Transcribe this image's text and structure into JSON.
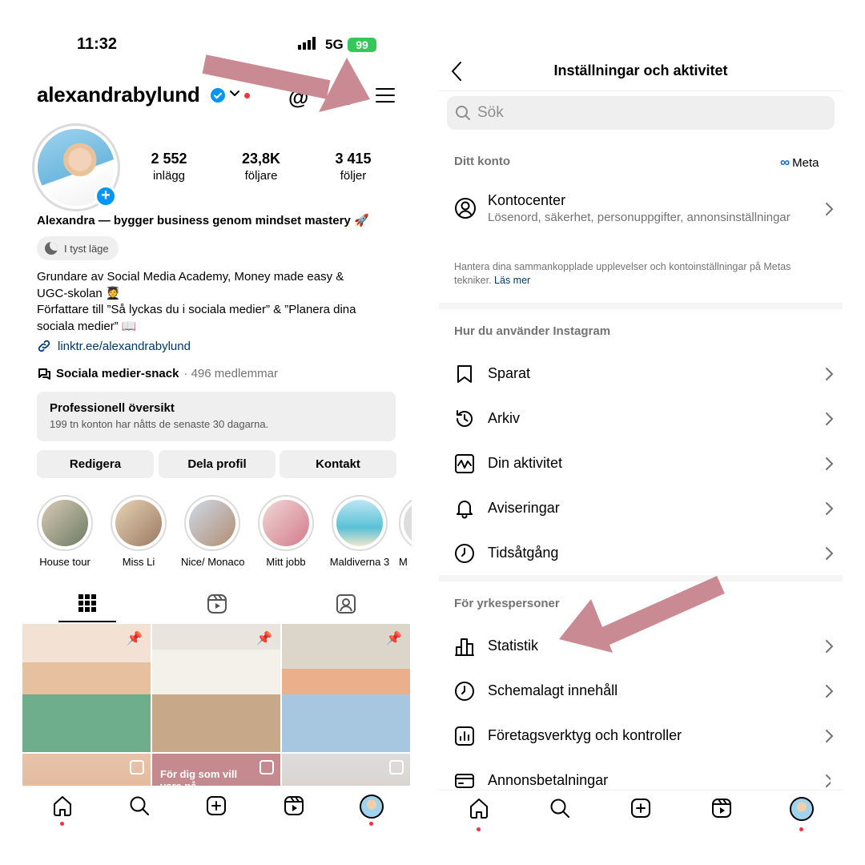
{
  "left": {
    "status": {
      "time": "11:32",
      "network": "5G",
      "battery": "99"
    },
    "header": {
      "username": "alexandrabylund"
    },
    "profile": {
      "stats": [
        {
          "value": "2 552",
          "label": "inlägg"
        },
        {
          "value": "23,8K",
          "label": "följare"
        },
        {
          "value": "3 415",
          "label": "följer"
        }
      ],
      "full_name": "Alexandra — bygger business genom mindset mastery 🚀",
      "quiet_mode": "I tyst läge",
      "bio_lines": [
        "Grundare av Social Media Academy, Money made easy &",
        "UGC-skolan 🧑‍🎓",
        "Författare till ”Så lyckas du i sociala medier” & ”Planera dina",
        "sociala medier” 📖"
      ],
      "link": "linktr.ee/alexandrabylund",
      "channel_name": "Sociala medier-snack",
      "channel_members": "· 496 medlemmar"
    },
    "pro_panel": {
      "title": "Professionell översikt",
      "subtitle": "199 tn konton har nåtts de senaste 30 dagarna."
    },
    "buttons": {
      "edit": "Redigera",
      "share": "Dela profil",
      "contact": "Kontakt"
    },
    "highlights": [
      {
        "label": "House tour"
      },
      {
        "label": "Miss Li"
      },
      {
        "label": "Nice/ Monaco"
      },
      {
        "label": "Mitt jobb"
      },
      {
        "label": "Maldiverna 3"
      },
      {
        "label": "M"
      }
    ],
    "grid_overlay_text": "För dig som vill\nvara på"
  },
  "right": {
    "title": "Inställningar och aktivitet",
    "search_placeholder": "Sök",
    "sections": {
      "account": "Ditt konto",
      "meta_brand": "Meta",
      "usage": "Hur du använder Instagram",
      "pro": "För yrkespersoner"
    },
    "account_center": {
      "title": "Kontocenter",
      "subtitle": "Lösenord, säkerhet, personuppgifter, annonsinställningar"
    },
    "note": {
      "text": "Hantera dina sammankopplade upplevelser och kontoinställningar på Metas tekniker.",
      "link": "Läs mer"
    },
    "usage_items": [
      {
        "label": "Sparat",
        "icon": "bookmark-icon"
      },
      {
        "label": "Arkiv",
        "icon": "archive-icon"
      },
      {
        "label": "Din aktivitet",
        "icon": "activity-icon"
      },
      {
        "label": "Aviseringar",
        "icon": "bell-icon"
      },
      {
        "label": "Tidsåtgång",
        "icon": "clock-icon"
      }
    ],
    "pro_items": [
      {
        "label": "Statistik",
        "icon": "bar-chart-icon"
      },
      {
        "label": "Schemalagt innehåll",
        "icon": "clock-icon"
      },
      {
        "label": "Företagsverktyg och kontroller",
        "icon": "chart-box-icon"
      },
      {
        "label": "Annonsbetalningar",
        "icon": "credit-card-icon"
      }
    ]
  },
  "colors": {
    "annotation_arrow": "#c98a93",
    "link_blue": "#00376b",
    "notification_red": "#ff3040",
    "verified_blue": "#0095f6"
  }
}
